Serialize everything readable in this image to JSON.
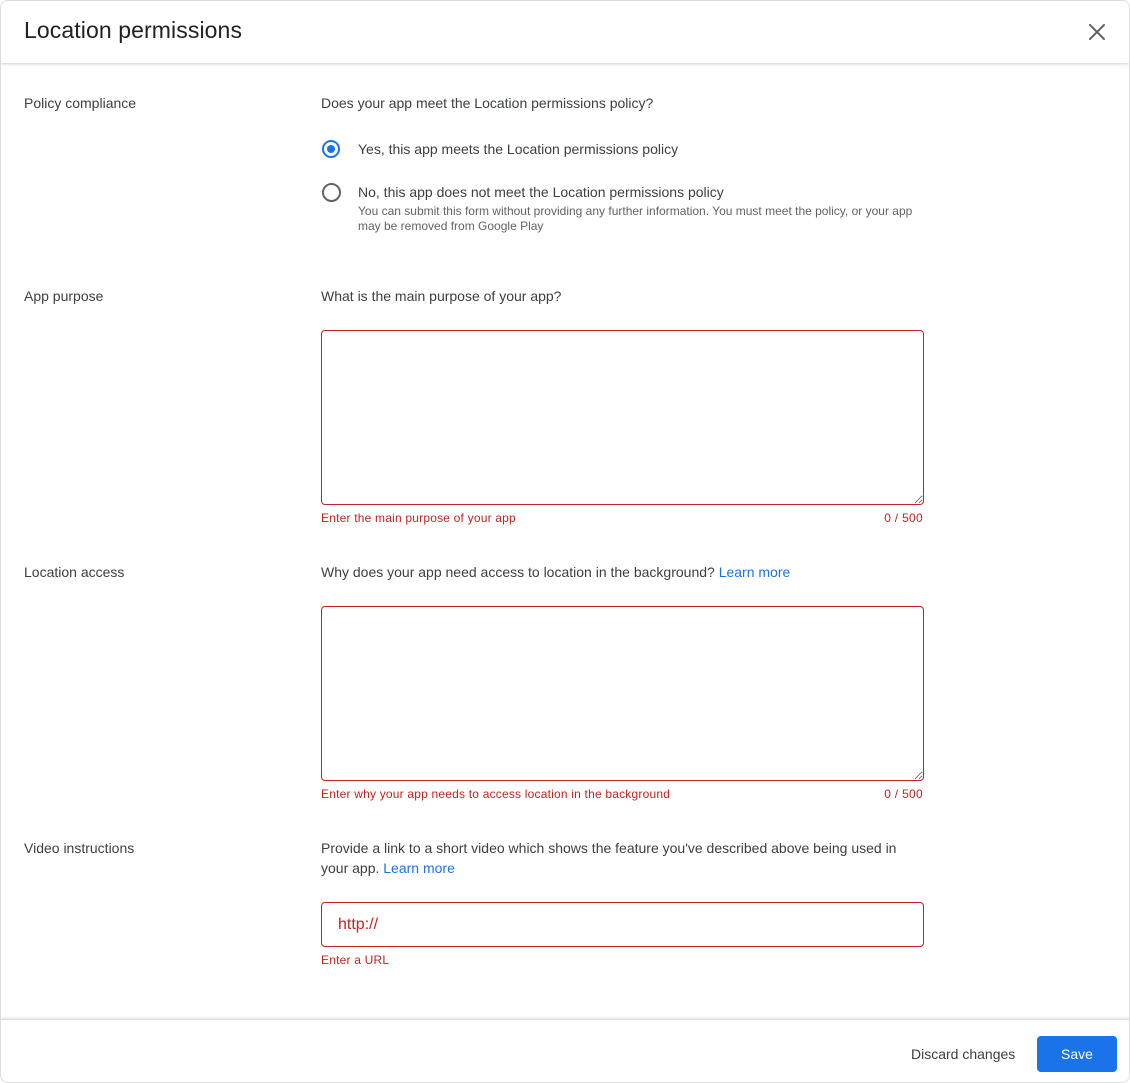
{
  "dialog": {
    "title": "Location permissions",
    "close_icon": "close-icon"
  },
  "policy": {
    "label": "Policy compliance",
    "question": "Does your app meet the Location permissions policy?",
    "options": [
      {
        "label": "Yes, this app meets the Location permissions policy",
        "selected": true
      },
      {
        "label": "No, this app does not meet the Location permissions policy",
        "selected": false,
        "help": "You can submit this form without providing any further information. You must meet the policy, or your app may be removed from Google Play"
      }
    ]
  },
  "purpose": {
    "label": "App purpose",
    "question": "What is the main purpose of your app?",
    "value": "",
    "error": "Enter the main purpose of your app",
    "counter": "0 / 500"
  },
  "access": {
    "label": "Location access",
    "question": "Why does your app need access to location in the background?",
    "link": "Learn more",
    "value": "",
    "error": "Enter why your app needs to access location in the background",
    "counter": "0 / 500"
  },
  "video": {
    "label": "Video instructions",
    "question": "Provide a link to a short video which shows the feature you've described above being used in your app.",
    "link": "Learn more",
    "placeholder": "http://",
    "error": "Enter a URL"
  },
  "footer": {
    "discard_label": "Discard changes",
    "save_label": "Save"
  },
  "colors": {
    "accent": "#1a73e8",
    "error": "#c5221f"
  }
}
